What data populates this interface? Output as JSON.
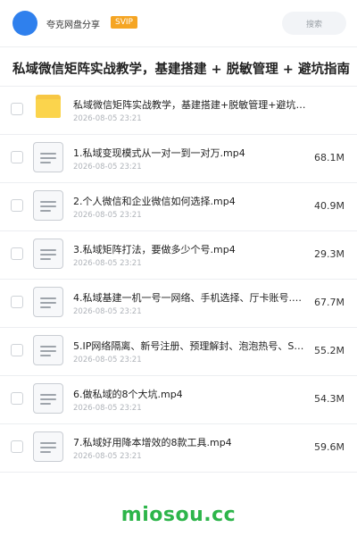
{
  "header": {
    "brand": "夸克网盘分享",
    "badge": "SVIP",
    "search_label": "搜索"
  },
  "page_title": "私域微信矩阵实战教学，基建搭建 + 脱敏管理 + 避坑指南",
  "files": [
    {
      "type": "folder",
      "name": "私域微信矩阵实战教学，基建搭建+脱敏管理+避坑指南",
      "date": "2026-08-05 23:21",
      "size": ""
    },
    {
      "type": "file",
      "name": "1.私域变现模式从一对一到一对万.mp4",
      "date": "2026-08-05 23:21",
      "size": "68.1M"
    },
    {
      "type": "file",
      "name": "2.个人微信和企业微信如何选择.mp4",
      "date": "2026-08-05 23:21",
      "size": "40.9M"
    },
    {
      "type": "file",
      "name": "3.私域矩阵打法，要做多少个号.mp4",
      "date": "2026-08-05 23:21",
      "size": "29.3M"
    },
    {
      "type": "file",
      "name": "4.私域基建一机一号一网络、手机选择、厅卡账号.m…",
      "date": "2026-08-05 23:21",
      "size": "67.7M"
    },
    {
      "type": "file",
      "name": "5.IP网络隔离、新号注册、预理解封、泡泡热号、S…",
      "date": "2026-08-05 23:21",
      "size": "55.2M"
    },
    {
      "type": "file",
      "name": "6.做私域的8个大坑.mp4",
      "date": "2026-08-05 23:21",
      "size": "54.3M"
    },
    {
      "type": "file",
      "name": "7.私域好用降本增效的8款工具.mp4",
      "date": "2026-08-05 23:21",
      "size": "59.6M"
    }
  ],
  "watermark": "miosou.cc",
  "colors": {
    "accent": "#2f80ed",
    "badge": "#f5a523",
    "folder": "#fbd44c",
    "watermark": "#2db54a"
  }
}
